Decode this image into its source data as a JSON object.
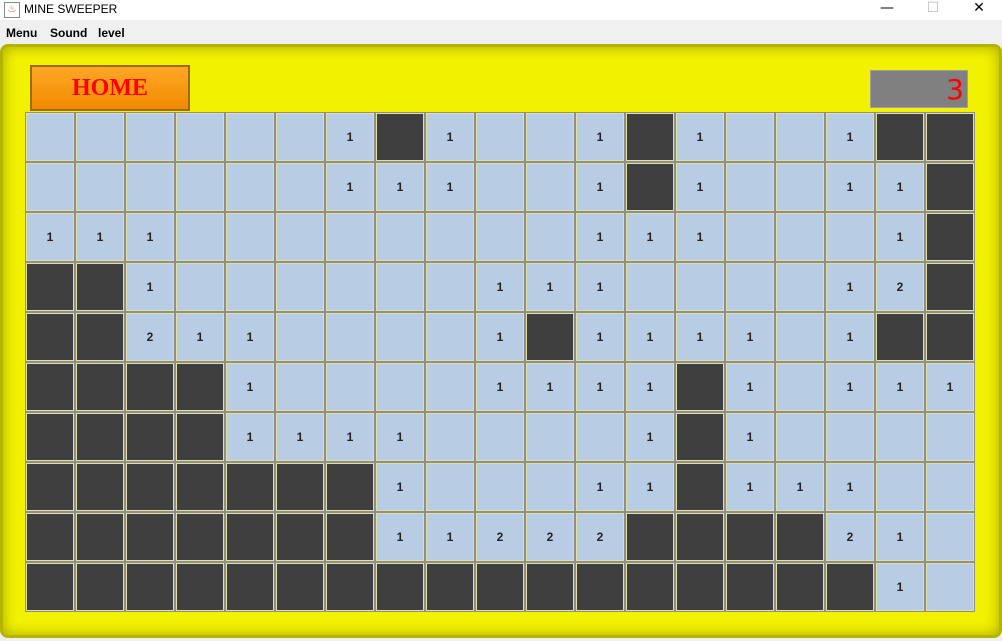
{
  "window": {
    "title": "MINE SWEEPER",
    "icon": "java-icon",
    "controls": {
      "minimize": "—",
      "maximize": "☐",
      "close": "✕"
    }
  },
  "menubar": {
    "items": [
      "Menu",
      "Sound",
      "level"
    ]
  },
  "game": {
    "home_label": "HOME",
    "counter": "3",
    "colors": {
      "panel": "#f2f200",
      "home": "#f39200",
      "home_text": "#ff0000",
      "open_cell": "#b8cde3",
      "hidden_cell": "#3f3f3f",
      "counter_bg": "#808080",
      "counter_text": "#ff0000"
    },
    "board": [
      [
        " ",
        " ",
        " ",
        " ",
        " ",
        " ",
        "1",
        "#",
        "1",
        " ",
        " ",
        "1",
        "#",
        "1",
        " ",
        " ",
        "1",
        "#",
        "#"
      ],
      [
        " ",
        " ",
        " ",
        " ",
        " ",
        " ",
        "1",
        "1",
        "1",
        " ",
        " ",
        "1",
        "#",
        "1",
        " ",
        " ",
        "1",
        "1",
        "#"
      ],
      [
        "1",
        "1",
        "1",
        " ",
        " ",
        " ",
        " ",
        " ",
        " ",
        " ",
        " ",
        "1",
        "1",
        "1",
        " ",
        " ",
        " ",
        "1",
        "#"
      ],
      [
        "#",
        "#",
        "1",
        " ",
        " ",
        " ",
        " ",
        " ",
        " ",
        "1",
        "1",
        "1",
        " ",
        " ",
        " ",
        " ",
        "1",
        "2",
        "#"
      ],
      [
        "#",
        "#",
        "2",
        "1",
        "1",
        " ",
        " ",
        " ",
        " ",
        "1",
        "#",
        "1",
        "1",
        "1",
        "1",
        " ",
        "1",
        "#",
        "#"
      ],
      [
        "#",
        "#",
        "#",
        "#",
        "1",
        " ",
        " ",
        " ",
        " ",
        "1",
        "1",
        "1",
        "1",
        "#",
        "1",
        " ",
        "1",
        "1",
        "1"
      ],
      [
        "#",
        "#",
        "#",
        "#",
        "1",
        "1",
        "1",
        "1",
        " ",
        " ",
        " ",
        " ",
        "1",
        "#",
        "1",
        " ",
        " ",
        " ",
        " "
      ],
      [
        "#",
        "#",
        "#",
        "#",
        "#",
        "#",
        "#",
        "1",
        " ",
        " ",
        " ",
        "1",
        "1",
        "#",
        "1",
        "1",
        "1",
        " ",
        " "
      ],
      [
        "#",
        "#",
        "#",
        "#",
        "#",
        "#",
        "#",
        "1",
        "1",
        "2",
        "2",
        "2",
        "#",
        "#",
        "#",
        "#",
        "2",
        "1",
        " "
      ],
      [
        "#",
        "#",
        "#",
        "#",
        "#",
        "#",
        "#",
        "#",
        "#",
        "#",
        "#",
        "#",
        "#",
        "#",
        "#",
        "#",
        "#",
        "1",
        " "
      ]
    ]
  }
}
